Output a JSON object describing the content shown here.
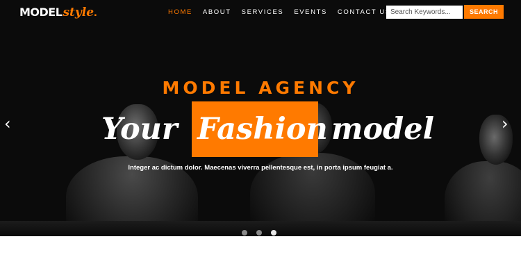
{
  "brand": {
    "main": "MODEL",
    "script": "style",
    "dot": "."
  },
  "nav": {
    "items": [
      {
        "label": "HOME",
        "active": true
      },
      {
        "label": "ABOUT",
        "active": false
      },
      {
        "label": "SERVICES",
        "active": false
      },
      {
        "label": "EVENTS",
        "active": false
      },
      {
        "label": "CONTACT US",
        "active": false
      }
    ]
  },
  "search": {
    "placeholder": "Search Keywords...",
    "button_label": "SEARCH"
  },
  "hero": {
    "eyebrow": "MODEL AGENCY",
    "headline_1": "Your",
    "headline_2": "Fashion",
    "headline_3": "model",
    "subtitle": "Integer ac dictum dolor. Maecenas viverra pellentesque est, in porta ipsum feugiat a.",
    "prev_icon": "‹",
    "next_icon": "›",
    "slides_count": 3,
    "active_slide": 3
  },
  "colors": {
    "accent": "#ff7a00",
    "background": "#0b0b0b",
    "text": "#ffffff"
  }
}
